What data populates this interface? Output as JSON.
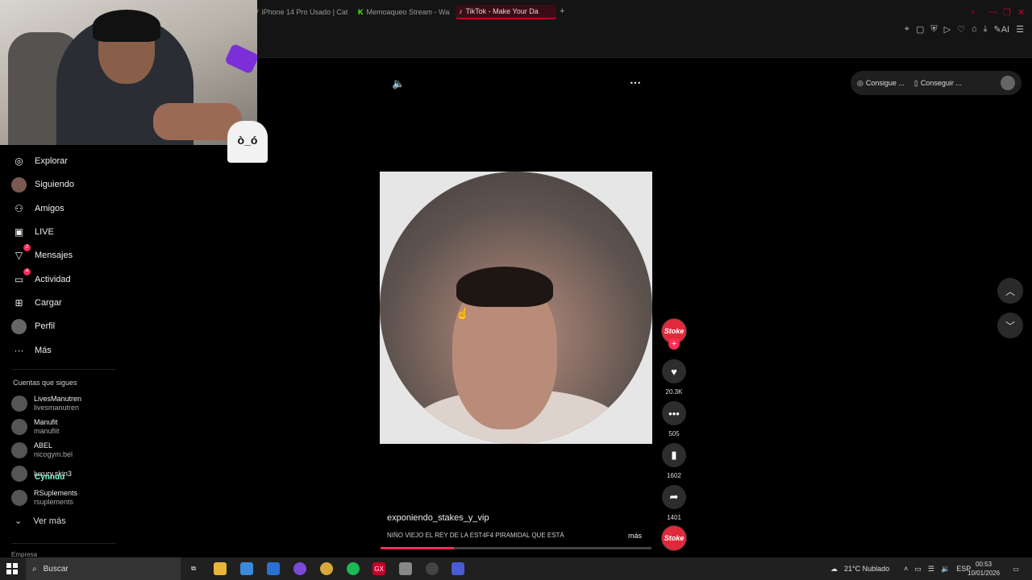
{
  "browser": {
    "tabs": [
      {
        "label": "iPhone 14 Pro Usado | Cat",
        "icon": "tab-favicon"
      },
      {
        "label": "Memoaqueo Stream - Wal",
        "icon": "kick-icon"
      },
      {
        "label": "TikTok - Make Your Da",
        "icon": "tiktok-icon",
        "active": true
      }
    ],
    "new_tab": "+",
    "accent": "#c4002b"
  },
  "webcam_overlay": {
    "ghost_face": "ò_ó"
  },
  "sidebar": {
    "nav": [
      {
        "label": "Explorar",
        "icon": "compass-icon"
      },
      {
        "label": "Siguiendo",
        "icon": "following-avatar-icon"
      },
      {
        "label": "Amigos",
        "icon": "friends-icon"
      },
      {
        "label": "LIVE",
        "icon": "live-icon"
      },
      {
        "label": "Mensajes",
        "icon": "messages-icon",
        "badge": "2"
      },
      {
        "label": "Actividad",
        "icon": "activity-icon",
        "badge": "4"
      },
      {
        "label": "Cargar",
        "icon": "upload-icon"
      },
      {
        "label": "Perfil",
        "icon": "profile-avatar-icon"
      },
      {
        "label": "Más",
        "icon": "more-icon"
      }
    ],
    "following_title": "Cuentas que sigues",
    "accounts": [
      {
        "name": "LivesManutren",
        "handle": "livesmanutren"
      },
      {
        "name": "Manufit",
        "handle": "manufiit"
      },
      {
        "name": "ABEL",
        "handle": "nicogym.bel"
      },
      {
        "name": "luxury.skin3",
        "handle": ""
      },
      {
        "name": "RSuplements",
        "handle": "rsuplements"
      }
    ],
    "overlay_chat_name": "Cynnuu",
    "see_more": "Ver más",
    "empresa": "Empresa"
  },
  "video": {
    "author": "exponiendo_stakes_y_vip",
    "description": "NIÑO  VIEJO EL REY DE LA EST4F4 PIRAMIDAL QUE ESTÁ",
    "more_label": "más",
    "progress": 0.27,
    "volume_icon": "speaker-icon",
    "options_icon": "ellipsis-icon"
  },
  "actions": {
    "avatar_text": "Stoke",
    "likes": "20.3K",
    "comments": "505",
    "saves": "1602",
    "shares": "1401"
  },
  "top_right": {
    "pill1": "Consigue ...",
    "pill2": "Conseguir ..."
  },
  "taskbar": {
    "search_placeholder": "Buscar",
    "weather": "21°C  Nublado",
    "lang": "ESP",
    "time": "00:53",
    "date": "10/01/2026"
  }
}
